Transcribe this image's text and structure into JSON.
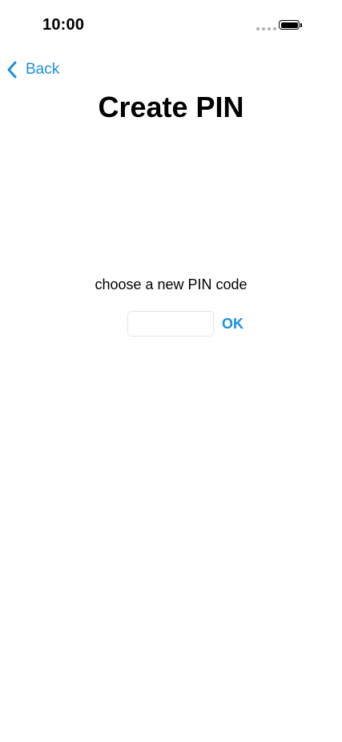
{
  "status_bar": {
    "time": "10:00"
  },
  "nav": {
    "back_label": "Back",
    "back_icon": "chevron-left-icon"
  },
  "page": {
    "title": "Create PIN",
    "prompt": "choose a new PIN code"
  },
  "pin_form": {
    "value": "",
    "placeholder": "",
    "ok_label": "OK"
  },
  "colors": {
    "accent": "#1c8fe3",
    "text": "#000000",
    "background": "#ffffff"
  }
}
